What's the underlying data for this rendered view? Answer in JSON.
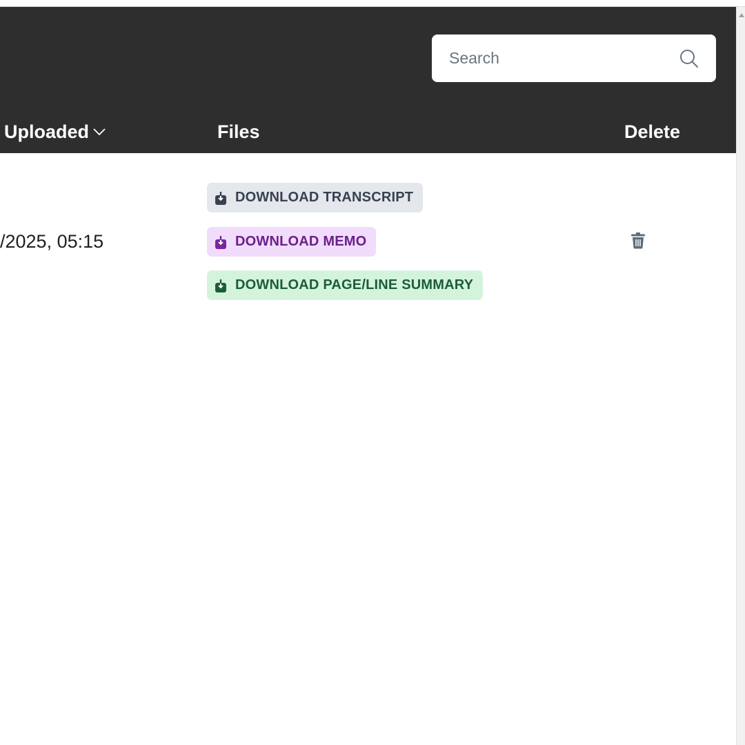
{
  "search": {
    "placeholder": "Search"
  },
  "columns": {
    "uploaded": "Uploaded",
    "files": "Files",
    "delete": "Delete"
  },
  "rows": [
    {
      "uploaded": "/2025, 05:15",
      "files": [
        {
          "label": "DOWNLOAD TRANSCRIPT",
          "color": "#374151",
          "bg": "#e4e7eb"
        },
        {
          "label": "DOWNLOAD MEMO",
          "color": "#6b1f8a",
          "bg": "#f1dcfb"
        },
        {
          "label": "DOWNLOAD PAGE/LINE SUMMARY",
          "color": "#1b5e37",
          "bg": "#d4f3dd"
        }
      ]
    }
  ],
  "icons": {
    "search": "search-icon",
    "sort": "chevron-down-icon",
    "download": "download-icon",
    "delete": "trash-icon"
  },
  "colors": {
    "header_bg": "#2e2e2e",
    "trash": "#5c6b7a"
  }
}
